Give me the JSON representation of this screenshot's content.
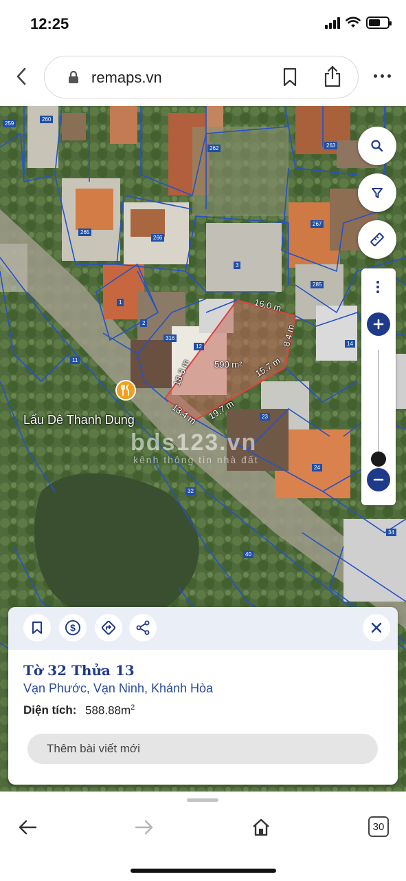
{
  "status_bar": {
    "time": "12:25"
  },
  "browser": {
    "url": "remaps.vn",
    "tab_count": "30"
  },
  "map": {
    "poi_name": "Lẩu Dê Thanh Dung",
    "watermark": "bds123.vn",
    "watermark_sub": "kênh thông tin nhà đất",
    "parcel_area_label": "590 m²",
    "dimensions": {
      "top": "16.0 m",
      "right_top": "8.4 m",
      "diagonal": "15.7 m",
      "left": "18.3 m",
      "bottom_left": "13.4 m",
      "bottom": "19.7 m"
    },
    "parcel_numbers": [
      "259",
      "260",
      "262",
      "263",
      "265",
      "266",
      "267",
      "3",
      "285",
      "1",
      "2",
      "316",
      "12",
      "14",
      "11",
      "23",
      "24",
      "32",
      "40",
      "34"
    ]
  },
  "info_card": {
    "title": "Tờ 32 Thửa 13",
    "address": "Vạn Phước, Vạn Ninh, Khánh Hòa",
    "area_label": "Diện tích:",
    "area_value": "588.88m",
    "area_unit_sup": "2",
    "new_post_label": "Thêm bài viết mới"
  },
  "colors": {
    "accent": "#1f3a8a",
    "parcel_line": "#2452c8",
    "highlight": "#d23a3a"
  },
  "icons": [
    "search-icon",
    "filter-icon",
    "ruler-icon",
    "zoom-in-icon",
    "zoom-out-icon",
    "bookmark-icon",
    "dollar-icon",
    "directions-icon",
    "share-icon",
    "close-icon"
  ]
}
